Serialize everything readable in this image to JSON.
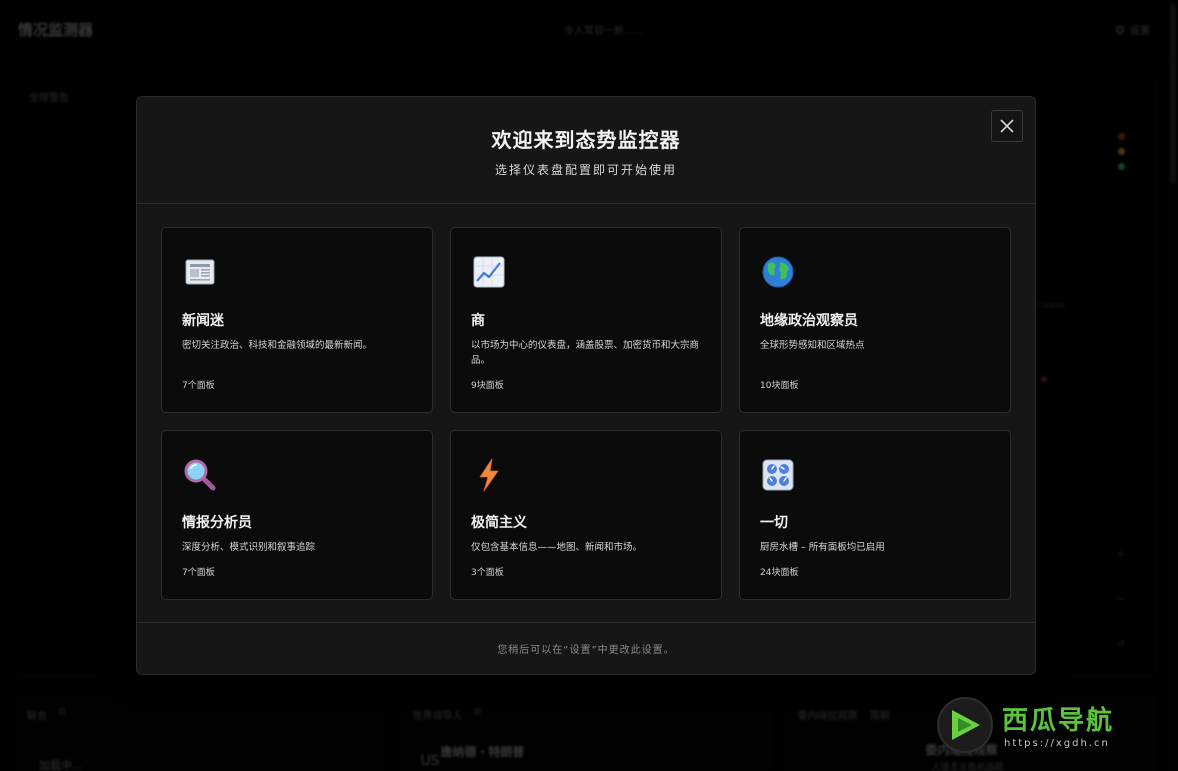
{
  "app": {
    "brand": "情况监测器",
    "center_text": "令人耳目一新……",
    "settings_label": "设置",
    "map_title": "全球警告",
    "map_label": "Tokens",
    "legend_colors": [
      "#c0392b",
      "#c9a227",
      "#2ecc71"
    ]
  },
  "bottom": {
    "panel1_title": "联合",
    "panel1_count": "0",
    "panel1_body": "加载中...",
    "panel2_title": "世界领导人",
    "panel2_count": "0",
    "panel2_code": "US",
    "panel2_name": "唐纳德・特朗普",
    "panel3_title": "委内瑞拉观察",
    "panel3_tag": "周期",
    "panel3_heading": "委内瑞拉观察",
    "panel3_sub": "人道主义危机追踪"
  },
  "modal": {
    "title": "欢迎来到态势监控器",
    "subtitle": "选择仪表盘配置即可开始使用",
    "footer": "您稍后可以在“设置”中更改此设置。",
    "close_icon": "close-icon",
    "cards": [
      {
        "icon": "newspaper-icon",
        "name": "新闻迷",
        "desc": "密切关注政治、科技和金融领域的最新新闻。",
        "count": "7个面板"
      },
      {
        "icon": "chart-up-icon",
        "name": "商",
        "desc": "以市场为中心的仪表盘，涵盖股票、加密货币和大宗商品。",
        "count": "9块面板"
      },
      {
        "icon": "globe-icon",
        "name": "地缘政治观察员",
        "desc": "全球形势感知和区域热点",
        "count": "10块面板"
      },
      {
        "icon": "magnifier-icon",
        "name": "情报分析员",
        "desc": "深度分析、模式识别和叙事追踪",
        "count": "7个面板"
      },
      {
        "icon": "lightning-icon",
        "name": "极简主义",
        "desc": "仅包含基本信息——地图、新闻和市场。",
        "count": "3个面板"
      },
      {
        "icon": "control-knobs-icon",
        "name": "一切",
        "desc": "厨房水槽 – 所有面板均已启用",
        "count": "24块面板"
      }
    ]
  },
  "watermark": {
    "text": "西瓜导航",
    "url": "https://xgdh.cn",
    "brand_color": "#5bc43c"
  }
}
